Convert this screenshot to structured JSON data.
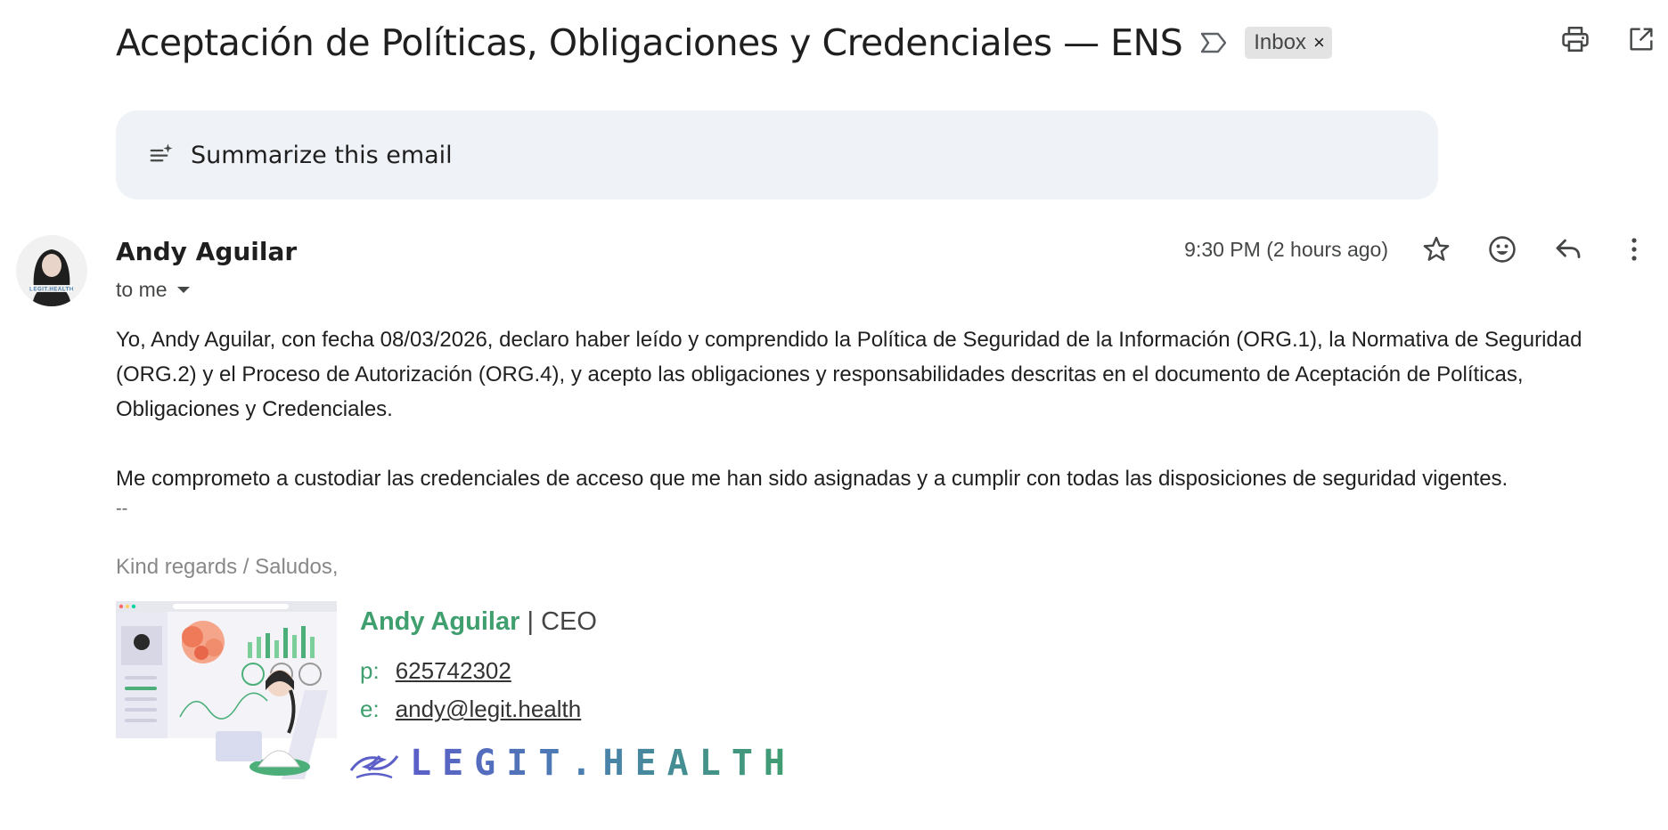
{
  "subject": "Aceptación de Políticas, Obligaciones y Credenciales — ENS",
  "label_chip": {
    "text": "Inbox",
    "remove": "×"
  },
  "summarize": {
    "label": "Summarize this email"
  },
  "message": {
    "sender": "Andy Aguilar",
    "recipient": "to me",
    "timestamp": "9:30 PM (2 hours ago)",
    "body": [
      "Yo, Andy Aguilar, con fecha 08/03/2026, declaro haber leído y comprendido la Política de Seguridad de la Información (ORG.1), la Normativa de Seguridad (ORG.2) y el Proceso de Autorización (ORG.4), y acepto las obligaciones y responsabilidades descritas en el documento de Aceptación de Políticas, Obligaciones y Credenciales.",
      "Me comprometo a custodiar las credenciales de acceso que me han sido asignadas y a cumplir con todas las disposiciones de seguridad vigentes."
    ],
    "separator": "--"
  },
  "signature": {
    "regards": "Kind regards / Saludos,",
    "name": "Andy Aguilar",
    "divider": "|",
    "role": "CEO",
    "phone_label": "p:",
    "phone": "625742302",
    "email_label": "e:",
    "email": "andy@legit.health",
    "logo_text": "LEGIT.HEALTH",
    "colors": {
      "green": "#3f9f6e",
      "indigo": "#5b5fc7"
    }
  },
  "icons": {
    "importance": "importance-marker-icon",
    "print": "print-icon",
    "open_new": "open-in-new-window-icon",
    "summarize": "summarize-sparkle-icon",
    "star": "star-icon",
    "emoji": "emoji-reaction-icon",
    "reply": "reply-icon",
    "more": "more-vertical-icon",
    "caret": "caret-down-icon"
  }
}
